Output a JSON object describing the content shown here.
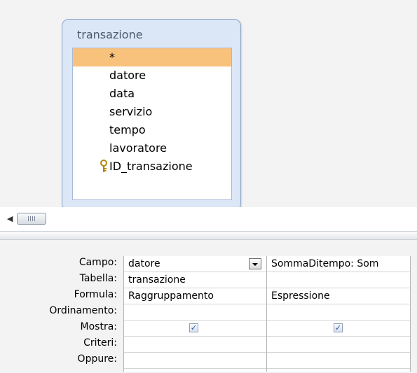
{
  "table": {
    "name": "transazione",
    "fields": [
      {
        "label": "*",
        "selected": true,
        "primary_key": false
      },
      {
        "label": "datore",
        "selected": false,
        "primary_key": false
      },
      {
        "label": "data",
        "selected": false,
        "primary_key": false
      },
      {
        "label": "servizio",
        "selected": false,
        "primary_key": false
      },
      {
        "label": "tempo",
        "selected": false,
        "primary_key": false
      },
      {
        "label": "lavoratore",
        "selected": false,
        "primary_key": false
      },
      {
        "label": "ID_transazione",
        "selected": false,
        "primary_key": true
      }
    ]
  },
  "icons": {
    "key": "primary-key-icon",
    "scroll_left": "scroll-left-arrow-icon",
    "dropdown": "dropdown-arrow-icon",
    "checkbox": "checkbox-checked-icon"
  },
  "colors": {
    "selected_field": "#f9c27c",
    "table_header": "#dbe6f6",
    "checkmark": "#2d58a8"
  },
  "grid": {
    "row_labels": [
      "Campo:",
      "Tabella:",
      "Formula:",
      "Ordinamento:",
      "Mostra:",
      "Criteri:",
      "Oppure:"
    ],
    "columns": [
      {
        "campo": "datore",
        "tabella": "transazione",
        "formula": "Raggruppamento",
        "ordinamento": "",
        "mostra": true,
        "criteri": "",
        "oppure": ""
      },
      {
        "campo": "SommaDitempo: Som",
        "tabella": "",
        "formula": "Espressione",
        "ordinamento": "",
        "mostra": true,
        "criteri": "",
        "oppure": ""
      }
    ]
  }
}
